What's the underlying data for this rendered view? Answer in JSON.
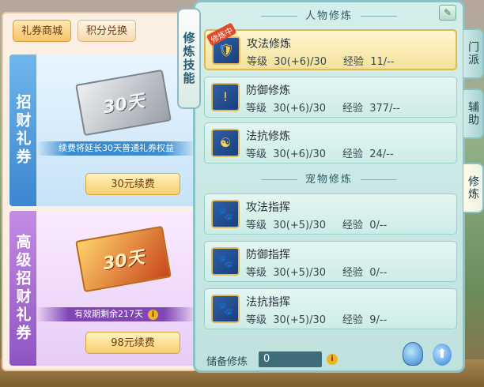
{
  "left_panel": {
    "tabs": [
      "礼券商城",
      "积分兑换"
    ],
    "cards": [
      {
        "side_title": "招财礼券",
        "ticket_text": "30天",
        "info": "续费将延长30天普通礼券权益",
        "button": "30元续费"
      },
      {
        "side_title": "高级招财礼券",
        "ticket_text": "30天",
        "info": "有效期剩余217天",
        "button": "98元续费"
      }
    ],
    "info_icon": "i"
  },
  "main": {
    "vertical_tab": "修炼技能",
    "sections": {
      "person": "人物修炼",
      "pet": "宠物修炼"
    },
    "edit_icon": "✎",
    "person_skills": [
      {
        "name": "攻法修炼",
        "level": "等级  30(+6)/30",
        "exp": "经验  11/--",
        "badge": "修炼中",
        "icon": "🛡"
      },
      {
        "name": "防御修炼",
        "level": "等级  30(+6)/30",
        "exp": "经验  377/--",
        "icon": "!"
      },
      {
        "name": "法抗修炼",
        "level": "等级  30(+6)/30",
        "exp": "经验  24/--",
        "icon": "☯"
      }
    ],
    "pet_skills": [
      {
        "name": "攻法指挥",
        "level": "等级  30(+5)/30",
        "exp": "经验  0/--",
        "icon": "🐾"
      },
      {
        "name": "防御指挥",
        "level": "等级  30(+5)/30",
        "exp": "经验  0/--",
        "icon": "🐾"
      },
      {
        "name": "法抗指挥",
        "level": "等级  30(+5)/30",
        "exp": "经验  9/--",
        "icon": "🐾"
      }
    ],
    "footer": {
      "label": "储备修炼",
      "value": "0",
      "info_icon": "i",
      "upgrade_icon": "⬆"
    }
  },
  "side_tabs": [
    "门派",
    "辅助",
    "修炼"
  ]
}
